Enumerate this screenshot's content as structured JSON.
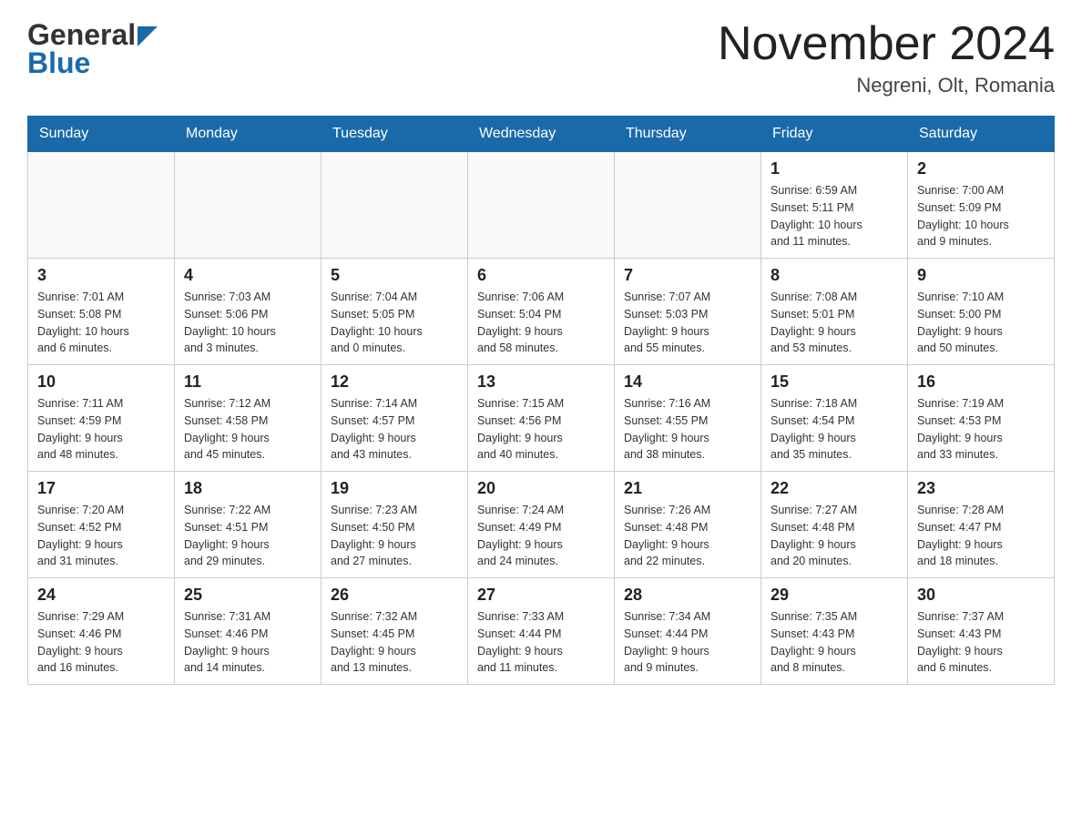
{
  "header": {
    "logo_line1": "General",
    "logo_line2": "Blue",
    "month_title": "November 2024",
    "location": "Negreni, Olt, Romania"
  },
  "days_of_week": [
    "Sunday",
    "Monday",
    "Tuesday",
    "Wednesday",
    "Thursday",
    "Friday",
    "Saturday"
  ],
  "weeks": [
    [
      {
        "day": "",
        "info": ""
      },
      {
        "day": "",
        "info": ""
      },
      {
        "day": "",
        "info": ""
      },
      {
        "day": "",
        "info": ""
      },
      {
        "day": "",
        "info": ""
      },
      {
        "day": "1",
        "info": "Sunrise: 6:59 AM\nSunset: 5:11 PM\nDaylight: 10 hours\nand 11 minutes."
      },
      {
        "day": "2",
        "info": "Sunrise: 7:00 AM\nSunset: 5:09 PM\nDaylight: 10 hours\nand 9 minutes."
      }
    ],
    [
      {
        "day": "3",
        "info": "Sunrise: 7:01 AM\nSunset: 5:08 PM\nDaylight: 10 hours\nand 6 minutes."
      },
      {
        "day": "4",
        "info": "Sunrise: 7:03 AM\nSunset: 5:06 PM\nDaylight: 10 hours\nand 3 minutes."
      },
      {
        "day": "5",
        "info": "Sunrise: 7:04 AM\nSunset: 5:05 PM\nDaylight: 10 hours\nand 0 minutes."
      },
      {
        "day": "6",
        "info": "Sunrise: 7:06 AM\nSunset: 5:04 PM\nDaylight: 9 hours\nand 58 minutes."
      },
      {
        "day": "7",
        "info": "Sunrise: 7:07 AM\nSunset: 5:03 PM\nDaylight: 9 hours\nand 55 minutes."
      },
      {
        "day": "8",
        "info": "Sunrise: 7:08 AM\nSunset: 5:01 PM\nDaylight: 9 hours\nand 53 minutes."
      },
      {
        "day": "9",
        "info": "Sunrise: 7:10 AM\nSunset: 5:00 PM\nDaylight: 9 hours\nand 50 minutes."
      }
    ],
    [
      {
        "day": "10",
        "info": "Sunrise: 7:11 AM\nSunset: 4:59 PM\nDaylight: 9 hours\nand 48 minutes."
      },
      {
        "day": "11",
        "info": "Sunrise: 7:12 AM\nSunset: 4:58 PM\nDaylight: 9 hours\nand 45 minutes."
      },
      {
        "day": "12",
        "info": "Sunrise: 7:14 AM\nSunset: 4:57 PM\nDaylight: 9 hours\nand 43 minutes."
      },
      {
        "day": "13",
        "info": "Sunrise: 7:15 AM\nSunset: 4:56 PM\nDaylight: 9 hours\nand 40 minutes."
      },
      {
        "day": "14",
        "info": "Sunrise: 7:16 AM\nSunset: 4:55 PM\nDaylight: 9 hours\nand 38 minutes."
      },
      {
        "day": "15",
        "info": "Sunrise: 7:18 AM\nSunset: 4:54 PM\nDaylight: 9 hours\nand 35 minutes."
      },
      {
        "day": "16",
        "info": "Sunrise: 7:19 AM\nSunset: 4:53 PM\nDaylight: 9 hours\nand 33 minutes."
      }
    ],
    [
      {
        "day": "17",
        "info": "Sunrise: 7:20 AM\nSunset: 4:52 PM\nDaylight: 9 hours\nand 31 minutes."
      },
      {
        "day": "18",
        "info": "Sunrise: 7:22 AM\nSunset: 4:51 PM\nDaylight: 9 hours\nand 29 minutes."
      },
      {
        "day": "19",
        "info": "Sunrise: 7:23 AM\nSunset: 4:50 PM\nDaylight: 9 hours\nand 27 minutes."
      },
      {
        "day": "20",
        "info": "Sunrise: 7:24 AM\nSunset: 4:49 PM\nDaylight: 9 hours\nand 24 minutes."
      },
      {
        "day": "21",
        "info": "Sunrise: 7:26 AM\nSunset: 4:48 PM\nDaylight: 9 hours\nand 22 minutes."
      },
      {
        "day": "22",
        "info": "Sunrise: 7:27 AM\nSunset: 4:48 PM\nDaylight: 9 hours\nand 20 minutes."
      },
      {
        "day": "23",
        "info": "Sunrise: 7:28 AM\nSunset: 4:47 PM\nDaylight: 9 hours\nand 18 minutes."
      }
    ],
    [
      {
        "day": "24",
        "info": "Sunrise: 7:29 AM\nSunset: 4:46 PM\nDaylight: 9 hours\nand 16 minutes."
      },
      {
        "day": "25",
        "info": "Sunrise: 7:31 AM\nSunset: 4:46 PM\nDaylight: 9 hours\nand 14 minutes."
      },
      {
        "day": "26",
        "info": "Sunrise: 7:32 AM\nSunset: 4:45 PM\nDaylight: 9 hours\nand 13 minutes."
      },
      {
        "day": "27",
        "info": "Sunrise: 7:33 AM\nSunset: 4:44 PM\nDaylight: 9 hours\nand 11 minutes."
      },
      {
        "day": "28",
        "info": "Sunrise: 7:34 AM\nSunset: 4:44 PM\nDaylight: 9 hours\nand 9 minutes."
      },
      {
        "day": "29",
        "info": "Sunrise: 7:35 AM\nSunset: 4:43 PM\nDaylight: 9 hours\nand 8 minutes."
      },
      {
        "day": "30",
        "info": "Sunrise: 7:37 AM\nSunset: 4:43 PM\nDaylight: 9 hours\nand 6 minutes."
      }
    ]
  ]
}
